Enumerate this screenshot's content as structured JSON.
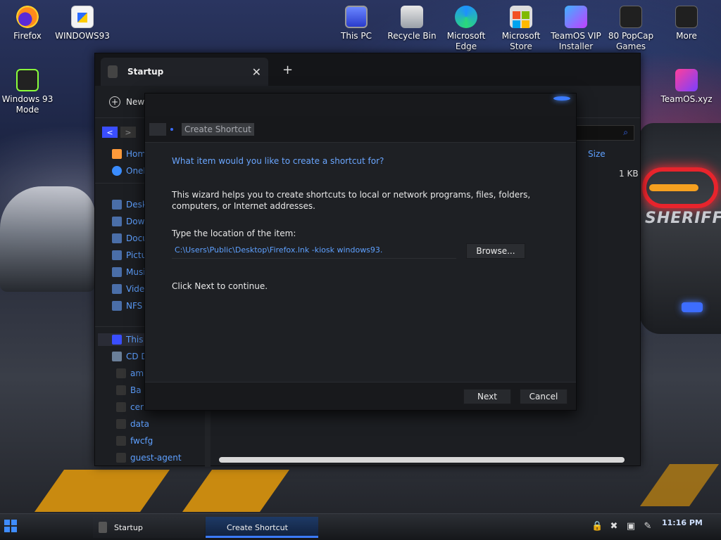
{
  "desktop": {
    "icons": [
      {
        "label": "Firefox"
      },
      {
        "label": "WINDOWS93"
      },
      {
        "label": "Windows 93 Mode"
      },
      {
        "label": "This PC"
      },
      {
        "label": "Recycle Bin"
      },
      {
        "label": "Microsoft Edge"
      },
      {
        "label": "Microsoft Store"
      },
      {
        "label": "TeamOS VIP Installer"
      },
      {
        "label": "80 PopCap Games"
      },
      {
        "label": "More"
      },
      {
        "label": "TeamOS.xyz"
      }
    ],
    "wallpaper_text": "SHERIFF"
  },
  "explorer": {
    "tab_title": "Startup",
    "tab_close": "✕",
    "new_tab": "+",
    "toolbar_new": "New",
    "nav_back": "<",
    "nav_forward": ">",
    "search_icon": "⌕",
    "nav_items": [
      {
        "label": "Home"
      },
      {
        "label": "OneDrive"
      },
      {
        "label": "Desktop"
      },
      {
        "label": "Downloads"
      },
      {
        "label": "Documents"
      },
      {
        "label": "Pictures"
      },
      {
        "label": "Music"
      },
      {
        "label": "Videos"
      },
      {
        "label": "NFS"
      },
      {
        "label": "This PC"
      },
      {
        "label": "CD Drive"
      },
      {
        "label": "am"
      },
      {
        "label": "Ba"
      },
      {
        "label": "cer"
      },
      {
        "label": "data"
      },
      {
        "label": "fwcfg"
      },
      {
        "label": "guest-agent"
      }
    ],
    "column_size": "Size",
    "file_size": "1 KB"
  },
  "dialog": {
    "header_title": "Create Shortcut",
    "question": "What item would you like to create a shortcut for?",
    "description": "This wizard helps you to create shortcuts to local or network programs, files, folders, computers, or Internet addresses.",
    "location_label": "Type the location of the item:",
    "location_value": "C:\\Users\\Public\\Desktop\\Firefox.lnk -kiosk windows93.",
    "browse_label": "Browse...",
    "continue_text": "Click Next to continue.",
    "next_label": "Next",
    "cancel_label": "Cancel"
  },
  "taskbar": {
    "items": [
      {
        "label": "Startup"
      },
      {
        "label": "Create Shortcut"
      }
    ],
    "clock": "11:16 PM",
    "accent": "#3b7bff"
  }
}
